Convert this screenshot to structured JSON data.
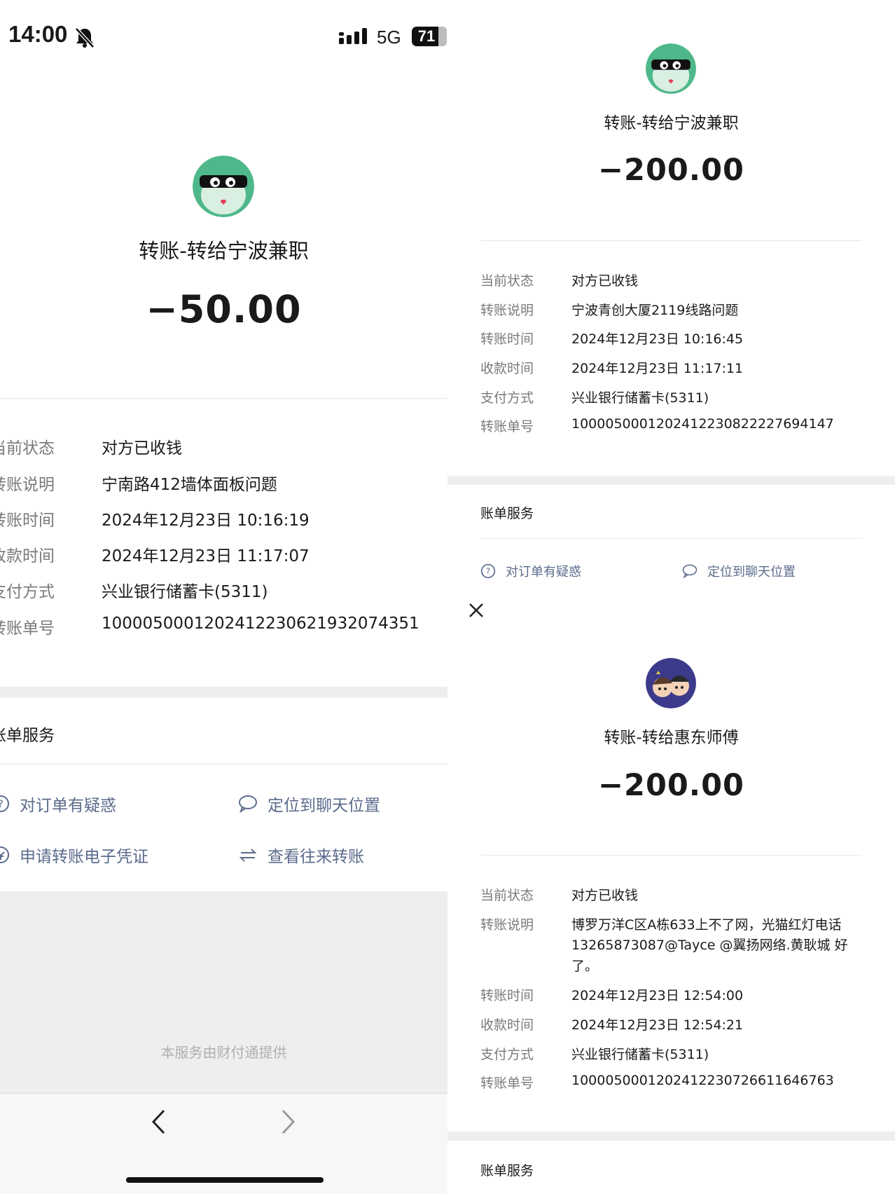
{
  "status_bar": {
    "time": "14:00",
    "network": "5G",
    "battery": "71"
  },
  "left": {
    "title": "转账-转给宁波兼职",
    "amount": "−50.00",
    "rows": [
      {
        "label": "当前状态",
        "value": "对方已收钱"
      },
      {
        "label": "转账说明",
        "value": "宁南路412墙体面板问题"
      },
      {
        "label": "转账时间",
        "value": "2024年12月23日 10:16:19"
      },
      {
        "label": "收款时间",
        "value": "2024年12月23日 11:17:07"
      },
      {
        "label": "支付方式",
        "value": "兴业银行储蓄卡(5311)"
      },
      {
        "label": "转账单号",
        "value": "1000050001202412230621932074351"
      }
    ],
    "services_title": "账单服务",
    "services": [
      "对订单有疑惑",
      "定位到聊天位置",
      "申请转账电子凭证",
      "查看往来转账"
    ],
    "footer": "本服务由财付通提供"
  },
  "right_top": {
    "title": "转账-转给宁波兼职",
    "amount": "−200.00",
    "rows": [
      {
        "label": "当前状态",
        "value": "对方已收钱"
      },
      {
        "label": "转账说明",
        "value": "宁波青创大厦2119线路问题"
      },
      {
        "label": "转账时间",
        "value": "2024年12月23日 10:16:45"
      },
      {
        "label": "收款时间",
        "value": "2024年12月23日 11:17:11"
      },
      {
        "label": "支付方式",
        "value": "兴业银行储蓄卡(5311)"
      },
      {
        "label": "转账单号",
        "value": "1000050001202412230822227694147"
      }
    ],
    "services_title": "账单服务",
    "services": [
      "对订单有疑惑",
      "定位到聊天位置"
    ]
  },
  "right_bottom": {
    "title": "转账-转给惠东师傅",
    "amount": "−200.00",
    "rows": [
      {
        "label": "当前状态",
        "value": "对方已收钱"
      },
      {
        "label": "转账说明",
        "value": "博罗万洋C区A栋633上不了网，光猫红灯电话",
        "value2": "13265873087@Tayce @翼扬网络.黄耿城 好",
        "value3": "了。"
      },
      {
        "label": "转账时间",
        "value": "2024年12月23日 12:54:00"
      },
      {
        "label": "收款时间",
        "value": "2024年12月23日 12:54:21"
      },
      {
        "label": "支付方式",
        "value": "兴业银行储蓄卡(5311)"
      },
      {
        "label": "转账单号",
        "value": "1000050001202412230726611646763"
      }
    ],
    "services_title": "账单服务"
  }
}
